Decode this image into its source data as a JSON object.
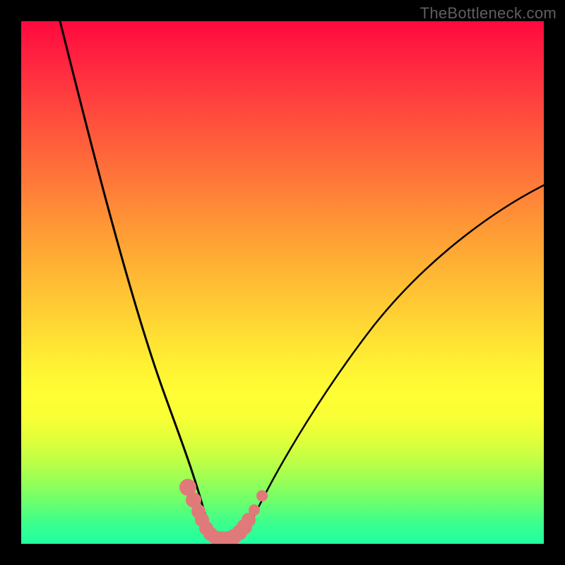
{
  "watermark": "TheBottleneck.com",
  "chart_data": {
    "type": "line",
    "title": "",
    "xlabel": "",
    "ylabel": "",
    "xlim": [
      0,
      100
    ],
    "ylim": [
      0,
      100
    ],
    "background_gradient": {
      "top": "#ff093e",
      "bottom": "#20ffa0",
      "description": "vertical red-to-green gradient (bottleneck heat)"
    },
    "series": [
      {
        "name": "curve-left",
        "x": [
          0,
          2,
          4,
          6,
          8,
          10,
          12,
          14,
          16,
          18,
          20,
          22,
          24,
          26,
          28,
          30,
          31,
          32,
          33,
          34,
          35
        ],
        "y": [
          100,
          95,
          89,
          83,
          77,
          70,
          63,
          56,
          49,
          42,
          35,
          28,
          22,
          16,
          11,
          6,
          4,
          3,
          2,
          1.5,
          1
        ],
        "stroke": "#000000",
        "stroke_width": 3
      },
      {
        "name": "curve-right",
        "x": [
          38,
          40,
          42,
          44,
          46,
          50,
          55,
          60,
          65,
          70,
          75,
          80,
          85,
          90,
          95,
          100
        ],
        "y": [
          1,
          2,
          4,
          6,
          9,
          14,
          21,
          28,
          34,
          40,
          46,
          51,
          56,
          60,
          64,
          67
        ],
        "stroke": "#000000",
        "stroke_width": 3
      },
      {
        "name": "markers",
        "type": "scatter",
        "color": "#e07a7a",
        "points": [
          {
            "x": 30,
            "y": 6,
            "r": 1.8
          },
          {
            "x": 31,
            "y": 4.5,
            "r": 1.5
          },
          {
            "x": 32,
            "y": 3,
            "r": 1.5
          },
          {
            "x": 33,
            "y": 2,
            "r": 1.5
          },
          {
            "x": 34,
            "y": 1.3,
            "r": 1.5
          },
          {
            "x": 35,
            "y": 1,
            "r": 1.5
          },
          {
            "x": 36,
            "y": 1,
            "r": 1.5
          },
          {
            "x": 37,
            "y": 1,
            "r": 1.8
          },
          {
            "x": 38.5,
            "y": 1.5,
            "r": 1.8
          },
          {
            "x": 39.5,
            "y": 2.3,
            "r": 1.8
          },
          {
            "x": 40.5,
            "y": 3.3,
            "r": 1.8
          },
          {
            "x": 42,
            "y": 5,
            "r": 1.2
          },
          {
            "x": 43.5,
            "y": 7.5,
            "r": 1.2
          }
        ]
      }
    ]
  }
}
